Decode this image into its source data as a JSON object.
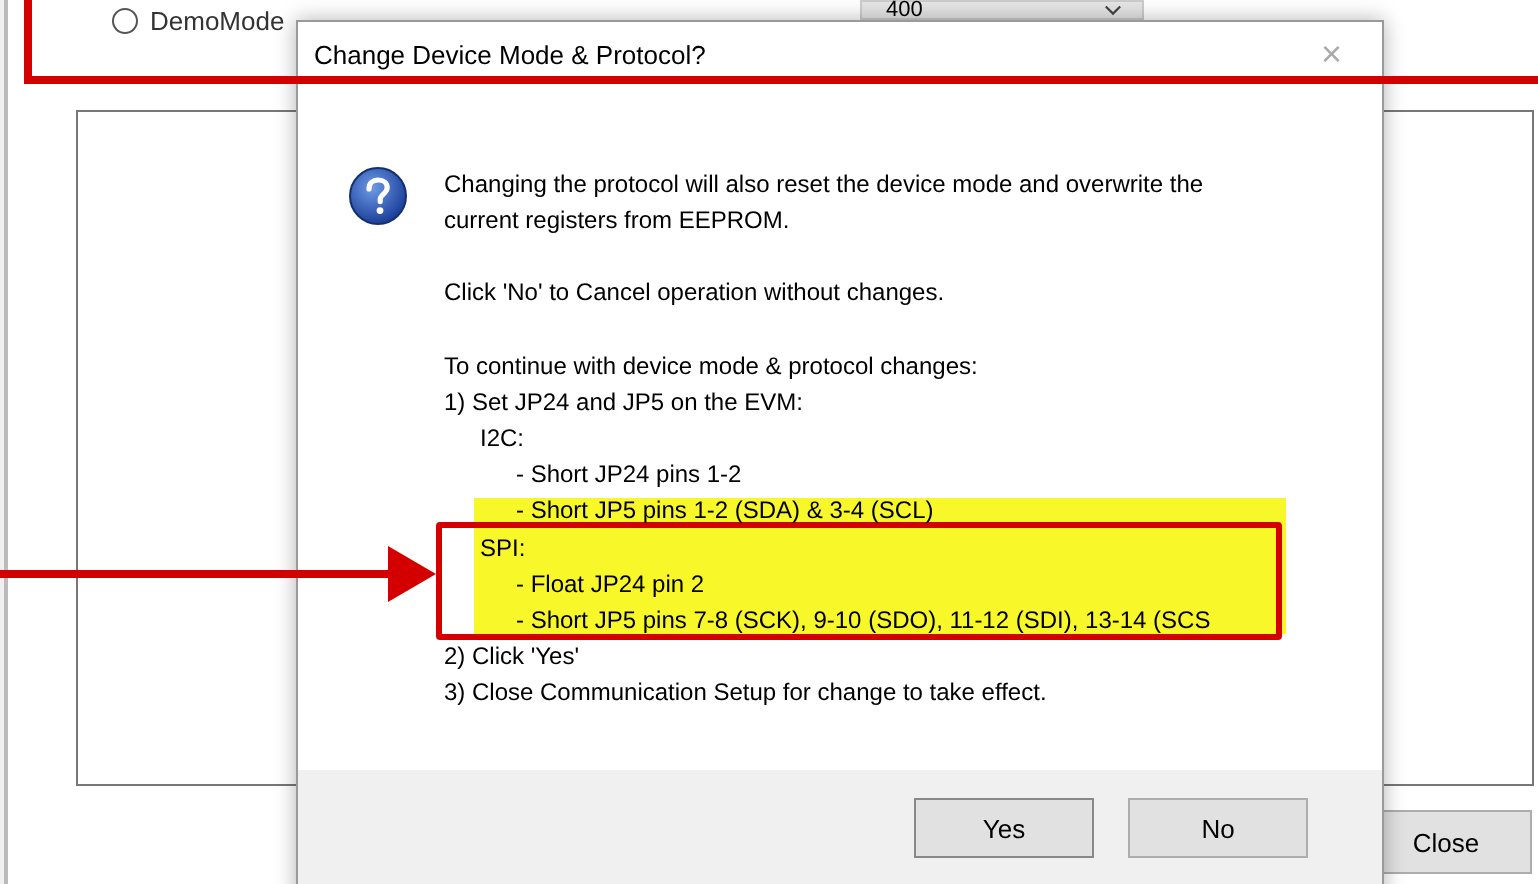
{
  "background_window": {
    "radio": {
      "label": "DemoMode",
      "selected": false
    },
    "dropdown": {
      "value": "400"
    },
    "close_button": "Close"
  },
  "dialog": {
    "title": "Change Device Mode & Protocol?",
    "close_glyph": "×",
    "lines": [
      {
        "text": "Changing the protocol will also reset the device mode and overwrite the current registers from EEPROM.",
        "kind": "para"
      },
      {
        "text": "Click 'No' to Cancel operation without changes.",
        "kind": "para"
      },
      {
        "text": "To continue with device mode & protocol changes:",
        "kind": "first"
      },
      {
        "text": "1) Set JP24 and JP5 on the EVM:",
        "kind": "line"
      },
      {
        "text": "I2C:",
        "kind": "sub"
      },
      {
        "text": "- Short JP24 pins 1-2",
        "kind": "subsub"
      },
      {
        "text": "- Short JP5 pins 1-2 (SDA) & 3-4 (SCL)",
        "kind": "subsub"
      },
      {
        "text": "SPI:",
        "kind": "sub"
      },
      {
        "text": "- Float JP24 pin 2",
        "kind": "subsub"
      },
      {
        "text": "- Short JP5 pins 7-8 (SCK), 9-10 (SDO), 11-12 (SDI), 13-14 (SCS",
        "kind": "subsub"
      },
      {
        "text": "2) Click 'Yes'",
        "kind": "line"
      },
      {
        "text": "3) Close Communication Setup for change to take effect.",
        "kind": "line"
      }
    ],
    "buttons": [
      "Yes",
      "No"
    ]
  }
}
